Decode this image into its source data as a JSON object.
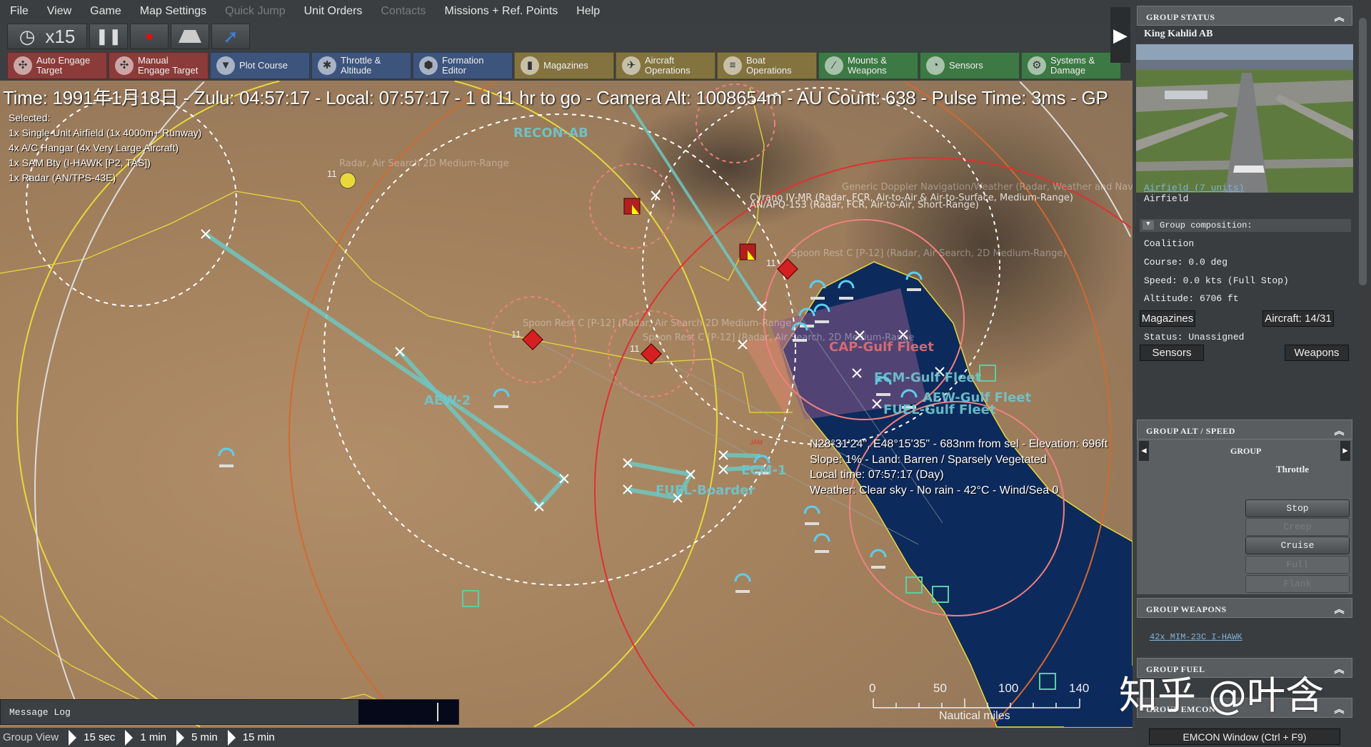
{
  "menu": [
    {
      "label": "File",
      "enabled": true
    },
    {
      "label": "View",
      "enabled": true
    },
    {
      "label": "Game",
      "enabled": true
    },
    {
      "label": "Map Settings",
      "enabled": true
    },
    {
      "label": "Quick Jump",
      "enabled": false
    },
    {
      "label": "Unit Orders",
      "enabled": true
    },
    {
      "label": "Contacts",
      "enabled": false
    },
    {
      "label": "Missions + Ref. Points",
      "enabled": true
    },
    {
      "label": "Help",
      "enabled": true
    }
  ],
  "controls": {
    "time_compression": "x15",
    "icons": [
      "clock-icon",
      "pause-icon",
      "record-icon",
      "runway-icon",
      "jump-arrow-icon"
    ]
  },
  "commands": [
    {
      "label1": "Auto Engage",
      "label2": "Target",
      "color": "red",
      "icon": "auto-engage-icon"
    },
    {
      "label1": "Manual",
      "label2": "Engage Target",
      "color": "red",
      "icon": "manual-engage-icon"
    },
    {
      "label1": "Plot Course",
      "label2": "",
      "color": "blue",
      "icon": "plot-course-icon"
    },
    {
      "label1": "Throttle &",
      "label2": "Altitude",
      "color": "blue",
      "icon": "throttle-icon"
    },
    {
      "label1": "Formation",
      "label2": "Editor",
      "color": "blue",
      "icon": "formation-icon"
    },
    {
      "label1": "Magazines",
      "label2": "",
      "color": "olive",
      "icon": "magazines-icon"
    },
    {
      "label1": "Aircraft",
      "label2": "Operations",
      "color": "olive",
      "icon": "aircraft-icon"
    },
    {
      "label1": "Boat",
      "label2": "Operations",
      "color": "olive",
      "icon": "boat-icon"
    },
    {
      "label1": "Mounts &",
      "label2": "Weapons",
      "color": "green",
      "icon": "mounts-icon"
    },
    {
      "label1": "Sensors",
      "label2": "",
      "color": "green",
      "icon": "sensors-icon"
    },
    {
      "label1": "Systems &",
      "label2": "Damage",
      "color": "green",
      "icon": "systems-icon"
    }
  ],
  "status_line": "Time: 1991年1月18日 - Zulu: 04:57:17 - Local: 07:57:17 - 1 d 11 hr to go -  Camera Alt: 1008654m  - AU Count: 638 - Pulse Time: 3ms - GP",
  "selected": {
    "title": "Selected:",
    "items": [
      "1x Single-Unit Airfield (1x 4000m+ Runway)",
      "4x A/C Hangar (4x Very Large Aircraft)",
      "1x SAM Bty (I-HAWK [P2, TAS])",
      "1x Radar (AN/TPS-43E)"
    ]
  },
  "map": {
    "mission_labels": [
      "RECON-AB",
      "AEW-2",
      "FUEL-Boarder",
      "ECM-1",
      "CAP-Gulf Fleet",
      "ECM-Gulf Fleet",
      "AEW-Gulf Fleet",
      "FUEL-Gulf Fleet"
    ],
    "sensor_labels": [
      "Radar, Air Search 2D Medium-Range",
      "Generic Doppler Navigation/Weather (Radar, Weather and Navig",
      "Cyrano IV-MR (Radar, FCR, Air-to-Air & Air-to-Surface, Medium-Range)",
      "AN/APQ-153 (Radar, FCR, Air-to-Air, Short-Range)",
      "Spoon Rest C [P-12] (Radar, Air Search 2D Medium-Range",
      "Spoon Rest C [P-12] (Radar, Air Search, 2D Medium-Range",
      "Spoon Rest C [P-12] (Radar, Air Search, 2D Medium-Range)"
    ],
    "unit_counts": [
      "11",
      "11",
      "11",
      "11"
    ],
    "jam_label": "JAM",
    "colors": {
      "sea": "#0d2a5c",
      "land": "#a4835f",
      "friendly": "#6fc7cf",
      "hostile": "#d42020",
      "border": "#e8d83a"
    }
  },
  "tooltip": [
    "N28°31'24\", E48°15'35\" - 683nm from sel - Elevation: 696ft",
    "Slope: 1%  - Land: Barren / Sparsely Vegetated",
    "Local time: 07:57:17 (Day)",
    "Weather: Clear sky - No rain - 42°C - Wind/Sea 0"
  ],
  "scale": {
    "ticks": [
      "0",
      "50",
      "100",
      "140"
    ],
    "unit": "Nautical miles"
  },
  "message_log": "Message Log",
  "bottom": {
    "label": "Group View",
    "steps": [
      "15 sec",
      "1 min",
      "5 min",
      "15 min"
    ]
  },
  "panel": {
    "status_header": "GROUP STATUS",
    "name": "King Kahlid AB",
    "link": "Airfield (7 units)",
    "type": "Airfield",
    "composition": "Group composition:",
    "side": "Coalition",
    "course": "Course: 0.0 deg",
    "speed": "Speed: 0.0 kts (Full Stop)",
    "altitude": "Altitude: 6706 ft",
    "magazines_btn": "Magazines",
    "aircraft_btn": "Aircraft: 14/31",
    "status": "Status: Unassigned",
    "sensors_btn": "Sensors",
    "weapons_btn": "Weapons",
    "alt_header": "GROUP ALT / SPEED",
    "group_label": "GROUP",
    "throttle_label": "Throttle",
    "throttle": [
      {
        "label": "Stop",
        "enabled": true
      },
      {
        "label": "Creep",
        "enabled": false
      },
      {
        "label": "Cruise",
        "enabled": true
      },
      {
        "label": "Full",
        "enabled": false
      },
      {
        "label": "Flank",
        "enabled": false
      }
    ],
    "weapons_header": "GROUP WEAPONS",
    "weapon": "42x MIM-23C I-HAWK",
    "fuel_header": "GROUP FUEL",
    "emcon_header": "GROUP EMCON",
    "emcon_btn": "EMCON Window (Ctrl + F9)"
  },
  "watermark": "知乎 @叶含"
}
